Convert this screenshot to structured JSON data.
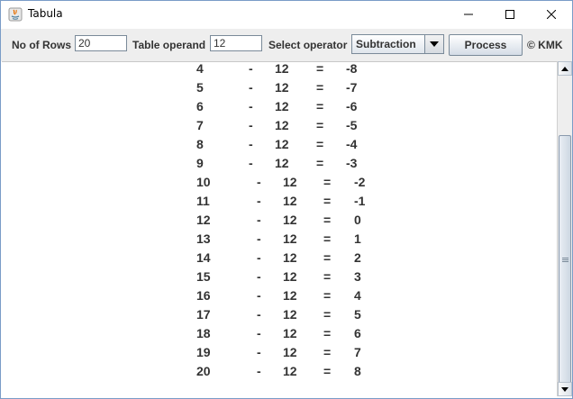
{
  "window": {
    "title": "Tabula"
  },
  "toolbar": {
    "rows_label": "No of Rows",
    "rows_value": "20",
    "operand_label": "Table operand",
    "operand_value": "12",
    "operator_label": "Select operator",
    "operator_value": "Subtraction",
    "process_label": "Process",
    "copyright": "© KMK"
  },
  "table": {
    "rows": [
      {
        "n": "4",
        "op": "-",
        "operand": "12",
        "eq": "=",
        "result": "-8"
      },
      {
        "n": "5",
        "op": "-",
        "operand": "12",
        "eq": "=",
        "result": "-7"
      },
      {
        "n": "6",
        "op": "-",
        "operand": "12",
        "eq": "=",
        "result": "-6"
      },
      {
        "n": "7",
        "op": "-",
        "operand": "12",
        "eq": "=",
        "result": "-5"
      },
      {
        "n": "8",
        "op": "-",
        "operand": "12",
        "eq": "=",
        "result": "-4"
      },
      {
        "n": "9",
        "op": "-",
        "operand": "12",
        "eq": "=",
        "result": "-3"
      },
      {
        "n": "10",
        "op": "-",
        "operand": "12",
        "eq": "=",
        "result": "-2"
      },
      {
        "n": "11",
        "op": "-",
        "operand": "12",
        "eq": "=",
        "result": "-1"
      },
      {
        "n": "12",
        "op": "-",
        "operand": "12",
        "eq": "=",
        "result": "0"
      },
      {
        "n": "13",
        "op": "-",
        "operand": "12",
        "eq": "=",
        "result": "1"
      },
      {
        "n": "14",
        "op": "-",
        "operand": "12",
        "eq": "=",
        "result": "2"
      },
      {
        "n": "15",
        "op": "-",
        "operand": "12",
        "eq": "=",
        "result": "3"
      },
      {
        "n": "16",
        "op": "-",
        "operand": "12",
        "eq": "=",
        "result": "4"
      },
      {
        "n": "17",
        "op": "-",
        "operand": "12",
        "eq": "=",
        "result": "5"
      },
      {
        "n": "18",
        "op": "-",
        "operand": "12",
        "eq": "=",
        "result": "6"
      },
      {
        "n": "19",
        "op": "-",
        "operand": "12",
        "eq": "=",
        "result": "7"
      },
      {
        "n": "20",
        "op": "-",
        "operand": "12",
        "eq": "=",
        "result": "8"
      }
    ]
  }
}
